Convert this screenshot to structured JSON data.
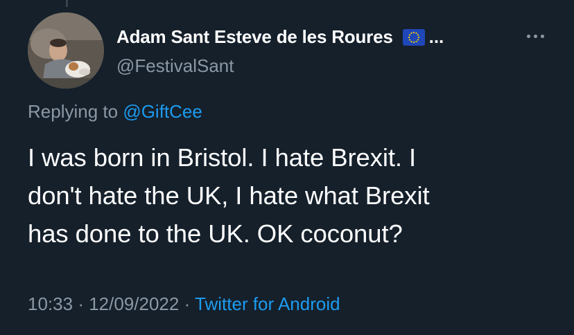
{
  "tweet": {
    "author": {
      "display_name": "Adam Sant Esteve de les Roures",
      "name_truncation": "...",
      "handle": "@FestivalSant",
      "badge_icon": "eu-flag-icon"
    },
    "reply_context": {
      "prefix": "Replying to",
      "mention": "@GiftCee"
    },
    "text_lines": [
      "I was born in Bristol. I hate Brexit. I",
      "don't hate the UK, I hate what Brexit",
      "has done to the UK. OK coconut?"
    ],
    "meta": {
      "time": "10:33",
      "separator": "·",
      "date": "12/09/2022",
      "source": "Twitter for Android"
    }
  },
  "colors": {
    "background": "#15202b",
    "primary_text": "#ffffff",
    "secondary_text": "#8b98a5",
    "accent": "#1d9bf0"
  }
}
